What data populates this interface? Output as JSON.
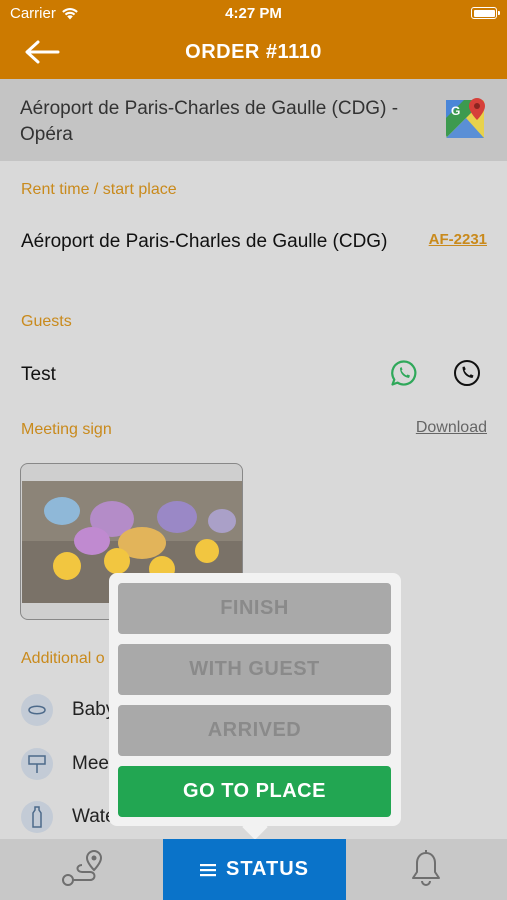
{
  "statusbar": {
    "carrier": "Carrier",
    "time": "4:27 PM"
  },
  "header": {
    "title": "ORDER #1110"
  },
  "route": {
    "text": "Aéroport de Paris-Charles de Gaulle (CDG) - Opéra"
  },
  "rent": {
    "label": "Rent time / start place",
    "place": "Aéroport de Paris-Charles de Gaulle (CDG)",
    "flight": "AF-2231"
  },
  "guests": {
    "label": "Guests",
    "name": "Test"
  },
  "meeting_sign": {
    "label": "Meeting sign",
    "download": "Download"
  },
  "additional": {
    "label": "Additional o",
    "items": [
      {
        "label": "Baby",
        "icon": "baby-seat-icon"
      },
      {
        "label": "Meet & Greet",
        "icon": "sign-post-icon"
      },
      {
        "label": "Water",
        "icon": "water-bottle-icon"
      }
    ]
  },
  "status_menu": {
    "finish": "FINISH",
    "with_guest": "WITH GUEST",
    "arrived": "ARRIVED",
    "go_to_place": "GO TO PLACE"
  },
  "tabbar": {
    "status": "STATUS"
  },
  "colors": {
    "header": "#cc7a00",
    "accent": "#c98a1c",
    "primary": "#22a652",
    "tab_active": "#0a73c9"
  }
}
